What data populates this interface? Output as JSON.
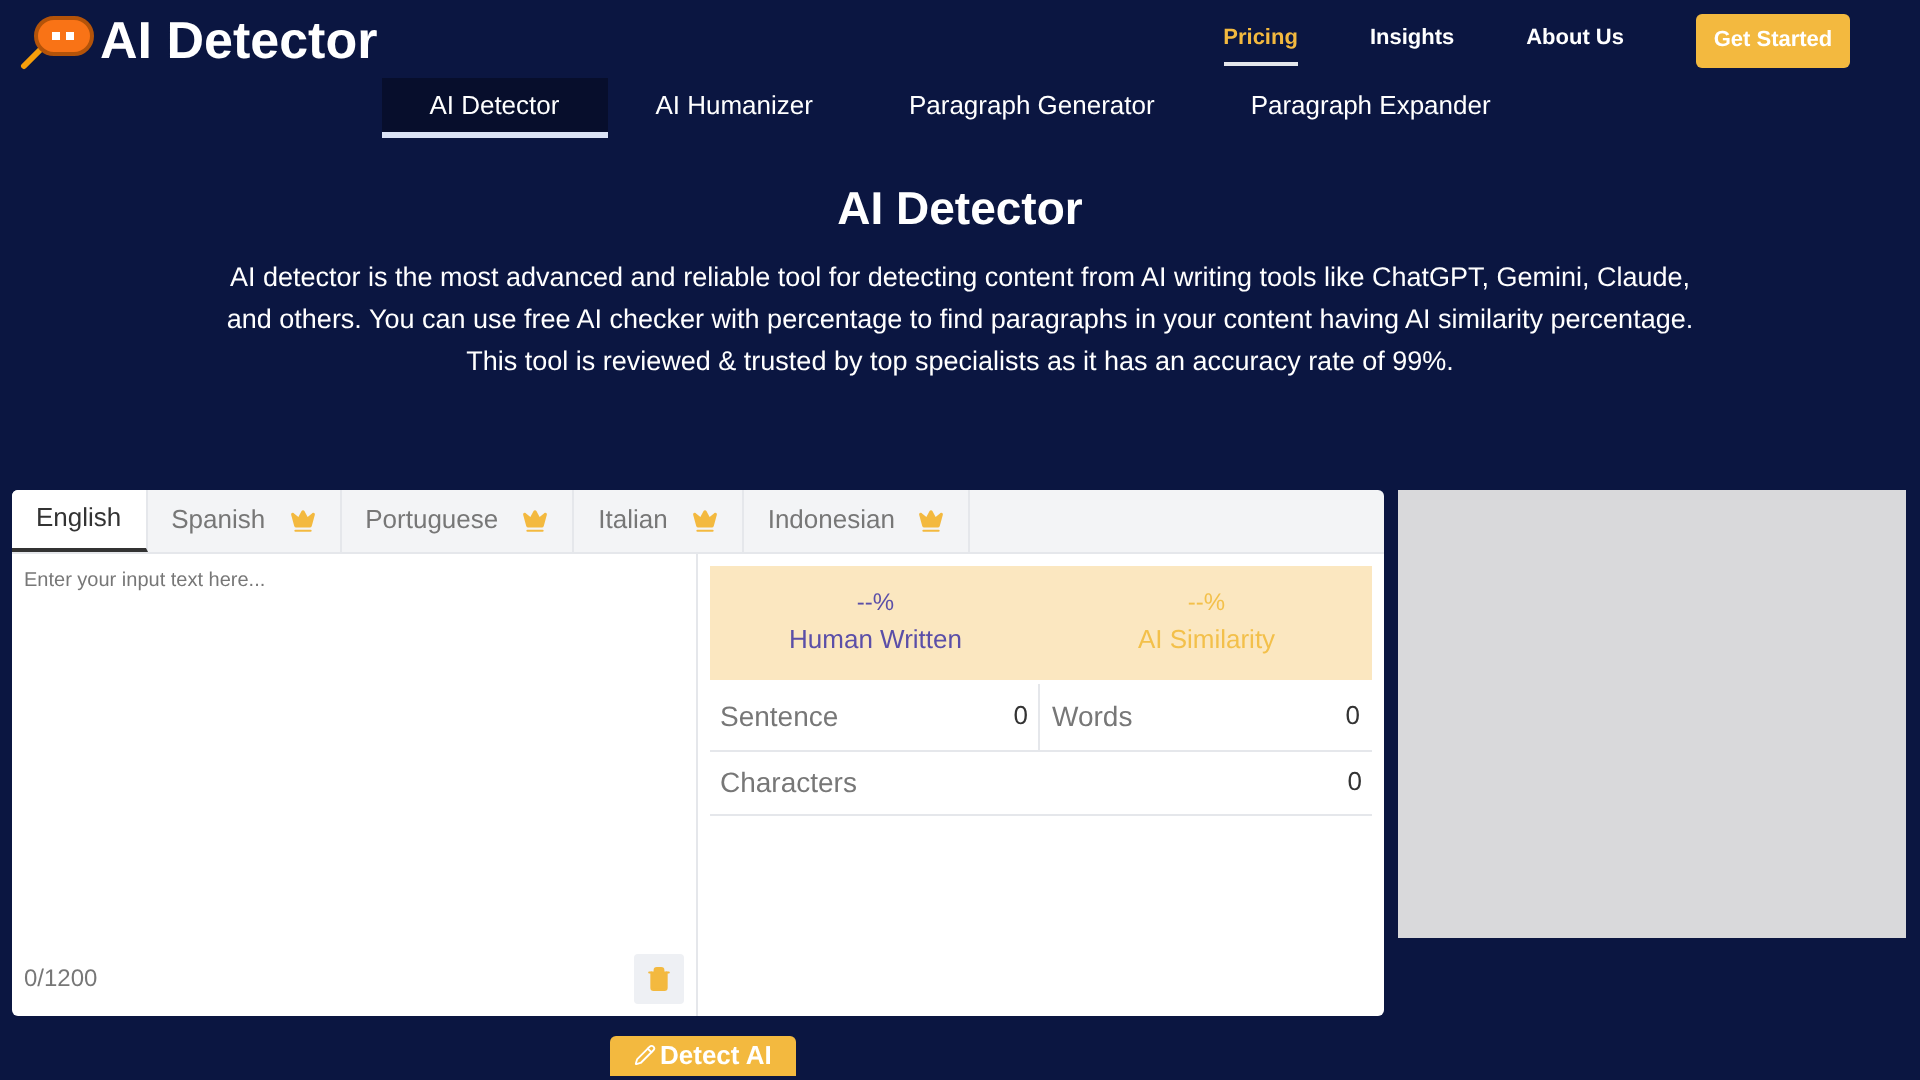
{
  "header": {
    "logo": "AI Detector",
    "nav": [
      {
        "label": "Pricing",
        "selected": true
      },
      {
        "label": "Insights",
        "selected": false
      },
      {
        "label": "About Us",
        "selected": false
      }
    ],
    "cta": "Get Started"
  },
  "tool_tabs": [
    {
      "label": "AI Detector",
      "selected": true
    },
    {
      "label": "AI Humanizer",
      "selected": false
    },
    {
      "label": "Paragraph Generator",
      "selected": false
    },
    {
      "label": "Paragraph Expander",
      "selected": false
    }
  ],
  "title": "AI Detector",
  "description": "AI detector is the most advanced and reliable tool for detecting content from AI writing tools like ChatGPT, Gemini, Claude, and others. You can use free AI checker with percentage to find paragraphs in your content having AI similarity percentage. This tool is reviewed & trusted by top specialists as it has an accuracy rate of 99%.",
  "languages": [
    {
      "label": "English",
      "selected": true,
      "premium": false
    },
    {
      "label": "Spanish",
      "selected": false,
      "premium": true
    },
    {
      "label": "Portuguese",
      "selected": false,
      "premium": true
    },
    {
      "label": "Italian",
      "selected": false,
      "premium": true
    },
    {
      "label": "Indonesian",
      "selected": false,
      "premium": true
    }
  ],
  "editor": {
    "placeholder": "Enter your input text here...",
    "counter": "0/1200"
  },
  "results": {
    "human": {
      "value": "--%",
      "label": "Human Written"
    },
    "ai": {
      "value": "--%",
      "label": "AI Similarity"
    }
  },
  "stats": {
    "sentence": {
      "label": "Sentence",
      "value": "0"
    },
    "words": {
      "label": "Words",
      "value": "0"
    },
    "characters": {
      "label": "Characters",
      "value": "0"
    }
  },
  "detect_button": "Detect AI"
}
